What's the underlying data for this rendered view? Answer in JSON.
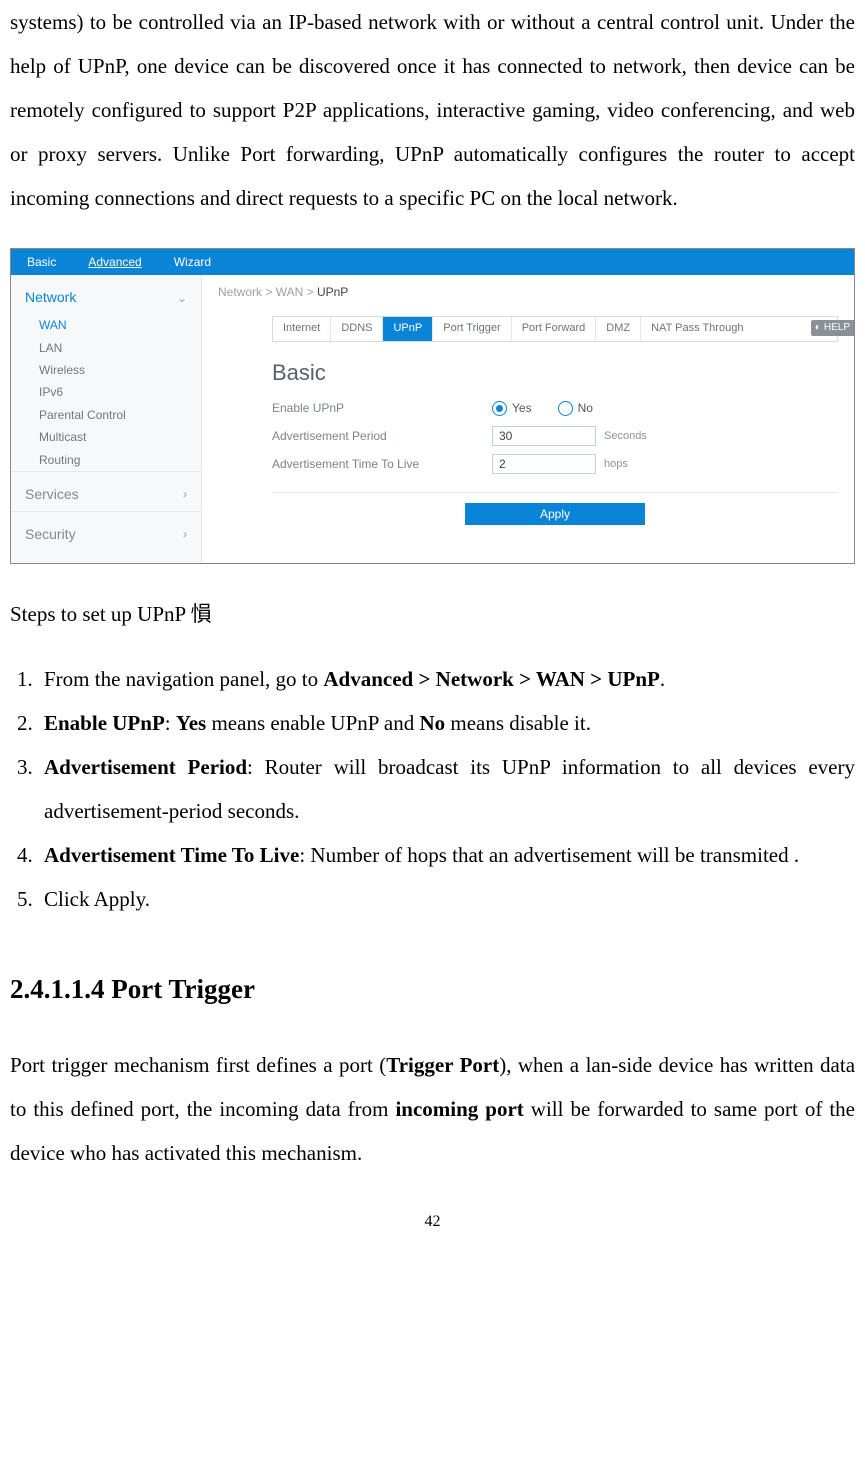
{
  "intro_para": "systems) to be controlled via an IP-based network with or without a central control unit. Under the help of UPnP, one device can be discovered once it has connected to network, then device can be remotely configured to support P2P applications, interactive gaming, video conferencing, and web or proxy servers. Unlike Port forwarding, UPnP automatically configures the router to accept incoming connections and direct requests to a specific PC on the local network.",
  "ui": {
    "topnav": {
      "basic": "Basic",
      "advanced": "Advanced",
      "wizard": "Wizard"
    },
    "sidebar": {
      "network_label": "Network",
      "items": [
        "WAN",
        "LAN",
        "Wireless",
        "IPv6",
        "Parental Control",
        "Multicast",
        "Routing"
      ],
      "services_label": "Services",
      "security_label": "Security"
    },
    "breadcrumb": {
      "a": "Network",
      "b": "WAN",
      "c": "UPnP"
    },
    "wan_tabs": [
      "Internet",
      "DDNS",
      "UPnP",
      "Port Trigger",
      "Port Forward",
      "DMZ",
      "NAT Pass Through"
    ],
    "help_label": "HELP",
    "panel_title": "Basic",
    "form": {
      "enable_label": "Enable UPnP",
      "yes": "Yes",
      "no": "No",
      "period_label": "Advertisement Period",
      "period_value": "30",
      "period_unit": "Seconds",
      "ttl_label": "Advertisement Time To Live",
      "ttl_value": "2",
      "ttl_unit": "hops"
    },
    "apply": "Apply"
  },
  "steps_intro": "Steps to set up UPnP 愪",
  "steps": {
    "s1a": "From the navigation panel, go to ",
    "s1b": "Advanced > Network > WAN > UPnP",
    "s1c": ".",
    "s2a": "Enable UPnP",
    "s2b": ": ",
    "s2c": "Yes",
    "s2d": " means enable UPnP and ",
    "s2e": "No",
    "s2f": " means disable it.",
    "s3a": "Advertisement Period",
    "s3b": ": Router will broadcast its UPnP information to all devices every advertisement-period seconds.",
    "s4a": "Advertisement Time To Live",
    "s4b": ": Number of hops that an advertisement will be transmited .",
    "s5": "Click Apply."
  },
  "section_heading": "2.4.1.1.4 Port Trigger",
  "port_trigger_para_a": "Port trigger mechanism first defines a port (",
  "port_trigger_para_b": "Trigger Port",
  "port_trigger_para_c": "), when a lan-side device has written data to this defined port, the incoming data from ",
  "port_trigger_para_d": "incoming port",
  "port_trigger_para_e": " will be forwarded to same port of the device who has activated this mechanism.",
  "page_number": "42"
}
